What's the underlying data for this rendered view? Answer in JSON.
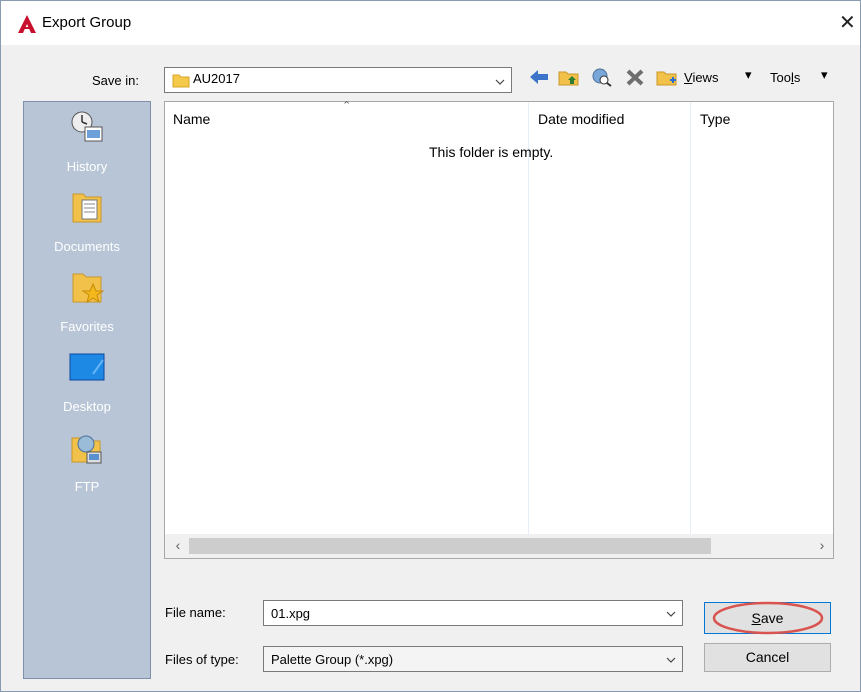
{
  "window": {
    "title": "Export Group",
    "close_glyph": "close-icon",
    "app_icon": "autocad-logo-icon"
  },
  "toolbar": {
    "save_in_label": "Save in:",
    "save_in_value": "AU2017",
    "views_label": "Views",
    "views_accesskey": "V",
    "tools_label": "Tools",
    "tools_accesskey": "l"
  },
  "sidebar": {
    "items": [
      {
        "label": "History",
        "icon": "history-icon"
      },
      {
        "label": "Documents",
        "icon": "documents-folder-icon"
      },
      {
        "label": "Favorites",
        "icon": "favorites-folder-icon"
      },
      {
        "label": "Desktop",
        "icon": "desktop-icon"
      },
      {
        "label": "FTP",
        "icon": "ftp-icon"
      }
    ]
  },
  "filelist": {
    "columns": [
      "Name",
      "Date modified",
      "Type"
    ],
    "empty_message": "This folder is empty."
  },
  "form": {
    "file_name_label": "File name:",
    "file_name_value": "01.xpg",
    "file_type_label": "Files of type:",
    "file_type_value": "Palette Group (*.xpg)"
  },
  "buttons": {
    "save": "Save",
    "cancel": "Cancel"
  },
  "colors": {
    "sidebar_bg": "#b8c5d7",
    "highlight_circle": "#d9534f",
    "autocad_red": "#c8102e"
  }
}
